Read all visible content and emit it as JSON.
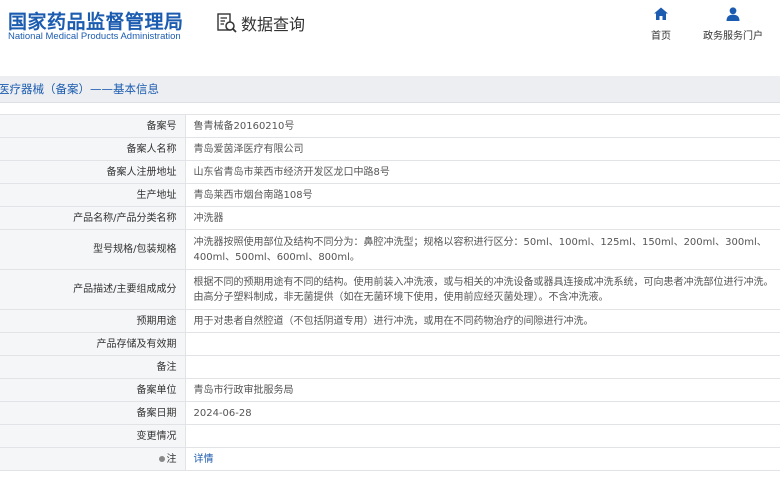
{
  "header": {
    "logo_cn": "国家药品监督管理局",
    "logo_en": "National Medical Products Administration",
    "query_title": "数据查询",
    "nav": [
      {
        "label": "首页",
        "icon": "home-icon"
      },
      {
        "label": "政务服务门户",
        "icon": "user-icon"
      }
    ]
  },
  "breadcrumb": "医疗器械（备案）——基本信息",
  "records": [
    {
      "key": "备案号",
      "value": "鲁青械备20160210号"
    },
    {
      "key": "备案人名称",
      "value": "青岛爱茵泽医疗有限公司"
    },
    {
      "key": "备案人注册地址",
      "value": "山东省青岛市莱西市经济开发区龙口中路8号"
    },
    {
      "key": "生产地址",
      "value": "青岛莱西市烟台南路108号"
    },
    {
      "key": "产品名称/产品分类名称",
      "value": "冲洗器"
    },
    {
      "key": "型号规格/包装规格",
      "value": "冲洗器按照使用部位及结构不同分为：鼻腔冲洗型；规格以容积进行区分：50ml、100ml、125ml、150ml、200ml、300ml、400ml、500ml、600ml、800ml。"
    },
    {
      "key": "产品描述/主要组成成分",
      "value": "根据不同的预期用途有不同的结构。使用前装入冲洗液，或与相关的冲洗设备或器具连接成冲洗系统，可向患者冲洗部位进行冲洗。由高分子塑料制成，非无菌提供（如在无菌环境下使用，使用前应经灭菌处理）。不含冲洗液。"
    },
    {
      "key": "预期用途",
      "value": "用于对患者自然腔道（不包括阴道专用）进行冲洗，或用在不同药物治疗的间隙进行冲洗。"
    },
    {
      "key": "产品存储及有效期",
      "value": ""
    },
    {
      "key": "备注",
      "value": ""
    },
    {
      "key": "备案单位",
      "value": "青岛市行政审批服务局"
    },
    {
      "key": "备案日期",
      "value": "2024-06-28"
    },
    {
      "key": "变更情况",
      "value": ""
    },
    {
      "key": "注",
      "value": "详情"
    }
  ],
  "colors": {
    "brand": "#1c5cb0",
    "label_bg": "#f5f6f8",
    "bar_bg": "#eceef1"
  }
}
